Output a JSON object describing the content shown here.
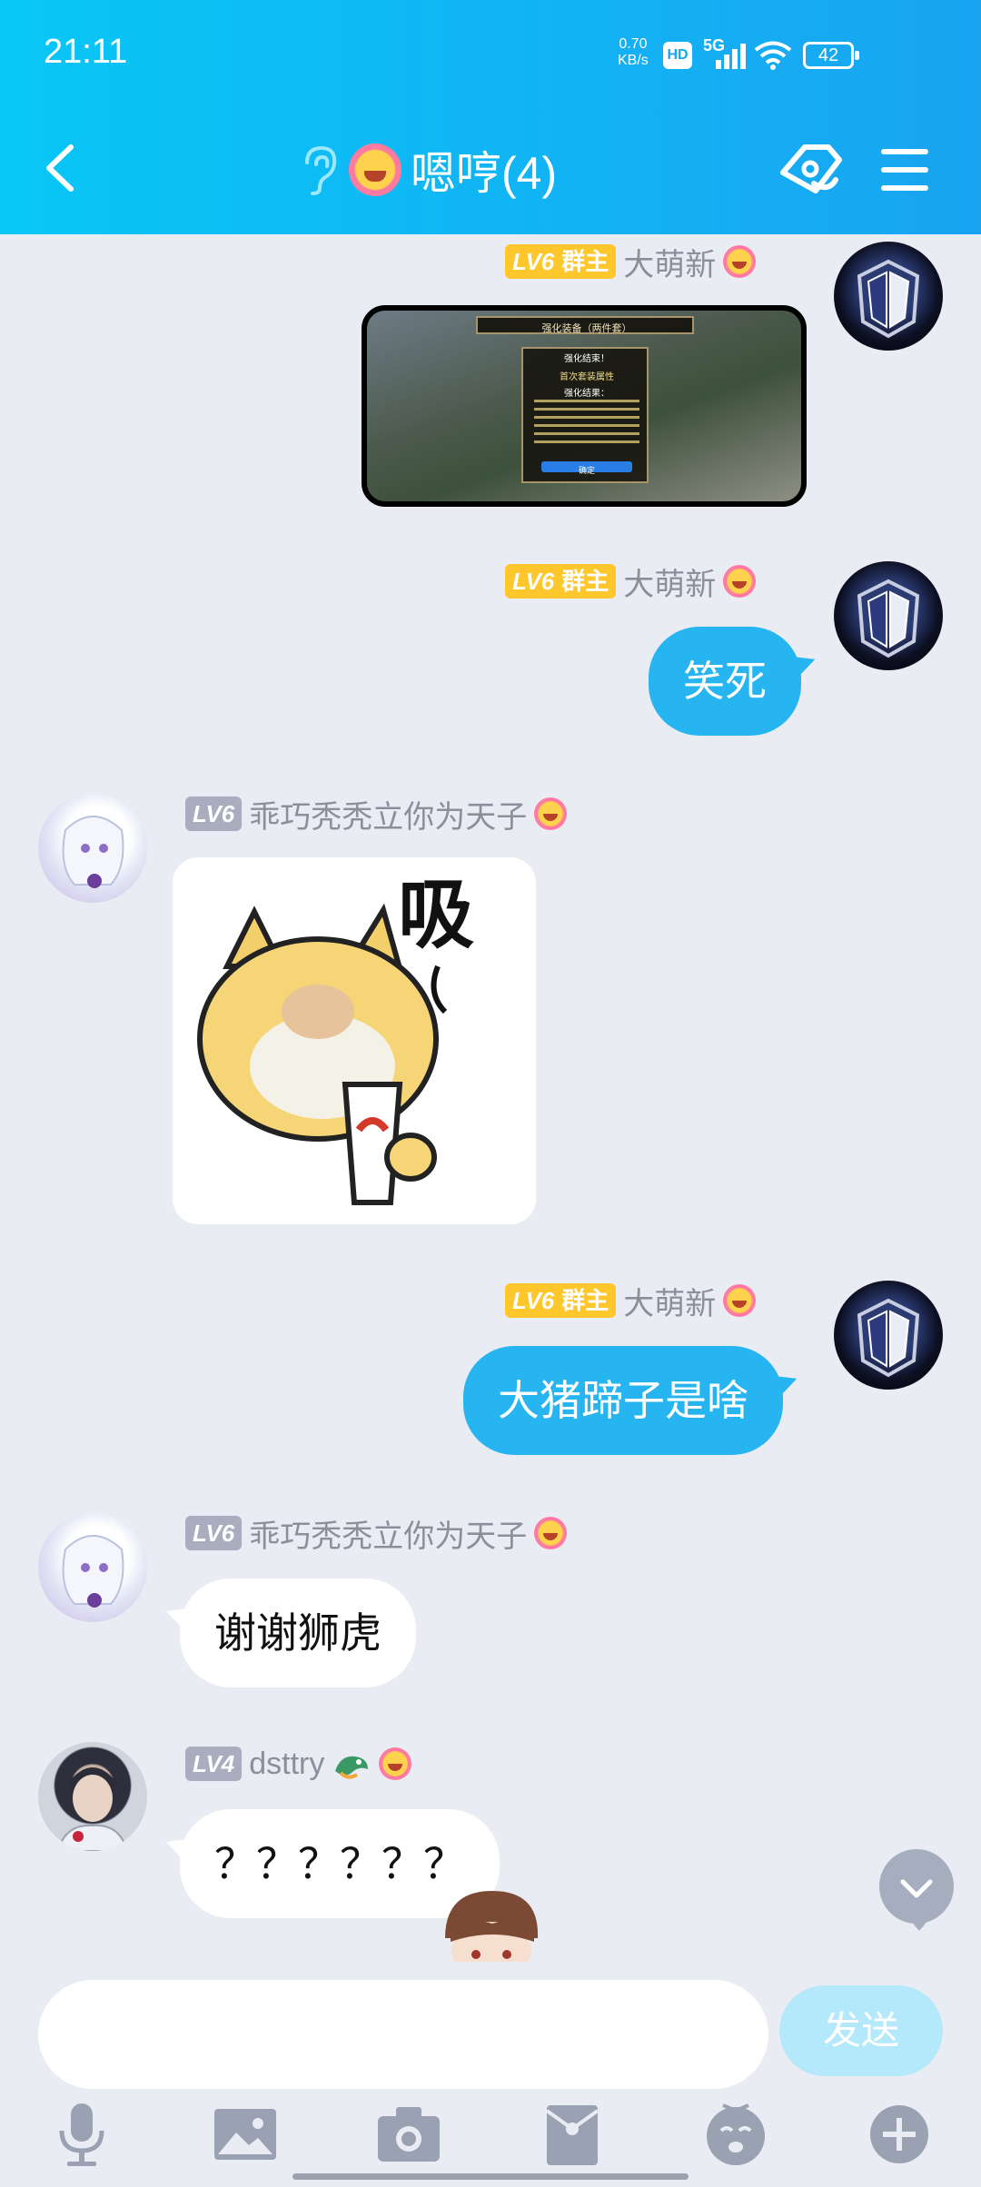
{
  "status_bar": {
    "time": "21:11",
    "net_speed_value": "0.70",
    "net_speed_unit": "KB/s",
    "hd": "HD",
    "network": "5G",
    "battery": "42"
  },
  "header": {
    "title": "嗯哼(4)",
    "accent_color": "#19a4f2"
  },
  "messages": [
    {
      "sender": "大萌新",
      "level": "LV6",
      "role": "群主",
      "side": "right",
      "type": "image",
      "image_text": {
        "title": "强化装备（两件套）",
        "panel_title": "强化结束！",
        "panel_sub": "首次套装属性",
        "panel_result": "强化结果：",
        "button": "确定"
      }
    },
    {
      "sender": "大萌新",
      "level": "LV6",
      "role": "群主",
      "side": "right",
      "type": "text",
      "text": "笑死"
    },
    {
      "sender": "乖巧秃秃立你为天子",
      "level": "LV6",
      "side": "left",
      "type": "sticker",
      "sticker_text": "吸"
    },
    {
      "sender": "大萌新",
      "level": "LV6",
      "role": "群主",
      "side": "right",
      "type": "text",
      "text": "大猪蹄子是啥"
    },
    {
      "sender": "乖巧秃秃立你为天子",
      "level": "LV6",
      "side": "left",
      "type": "text",
      "text": "谢谢狮虎"
    },
    {
      "sender": "dsttry",
      "level": "LV4",
      "side": "left",
      "type": "text",
      "text": "？？？？？？"
    }
  ],
  "input": {
    "placeholder": "",
    "value": "",
    "send_label": "发送"
  },
  "toolbar": [
    "mic-icon",
    "image-icon",
    "camera-icon",
    "red-packet-icon",
    "emoji-icon",
    "plus-icon"
  ]
}
